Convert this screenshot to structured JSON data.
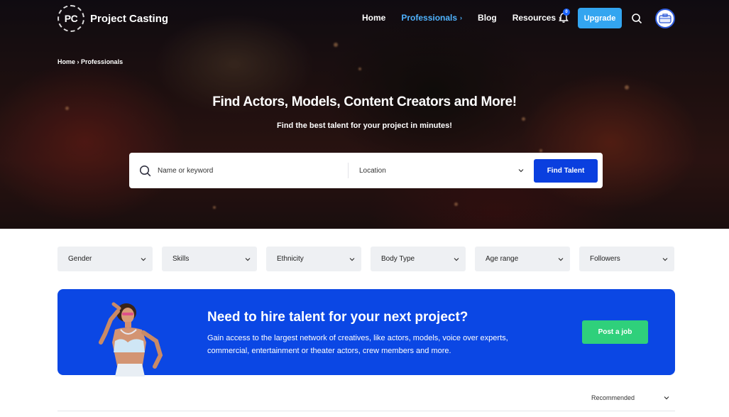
{
  "nav": {
    "logo_mark": "PC",
    "logo_text": "Project Casting",
    "links": [
      {
        "label": "Home",
        "active": false,
        "has_chevron": false
      },
      {
        "label": "Professionals",
        "active": true,
        "has_chevron": true
      },
      {
        "label": "Blog",
        "active": false,
        "has_chevron": false
      },
      {
        "label": "Resources",
        "active": false,
        "has_chevron": true
      }
    ],
    "notification_count": "0",
    "upgrade_label": "Upgrade",
    "icons": [
      "bell-icon",
      "search-icon",
      "avatar-icon"
    ]
  },
  "breadcrumb": {
    "items": [
      "Home",
      "Professionals"
    ],
    "separator": "›"
  },
  "hero": {
    "title": "Find Actors, Models, Content Creators and More!",
    "subtitle": "Find the best talent for your project in minutes!"
  },
  "search": {
    "keyword_placeholder": "Name or keyword",
    "location_placeholder": "Location",
    "button_label": "Find Talent"
  },
  "filters": [
    "Gender",
    "Skills",
    "Ethnicity",
    "Body Type",
    "Age range",
    "Followers"
  ],
  "promo": {
    "title": "Need to hire talent for your next project?",
    "text": "Gain access to the largest network of creatives, like actors, models, voice over experts, commercial, entertainment or theater actors, crew members and more.",
    "button_label": "Post a job"
  },
  "sort": {
    "selected": "Recommended"
  },
  "colors": {
    "accent_blue": "#0a3fdf",
    "promo_blue": "#0b47e4",
    "upgrade_blue": "#33a5f0",
    "active_link": "#4fb3ff",
    "post_green": "#2fd07b"
  }
}
